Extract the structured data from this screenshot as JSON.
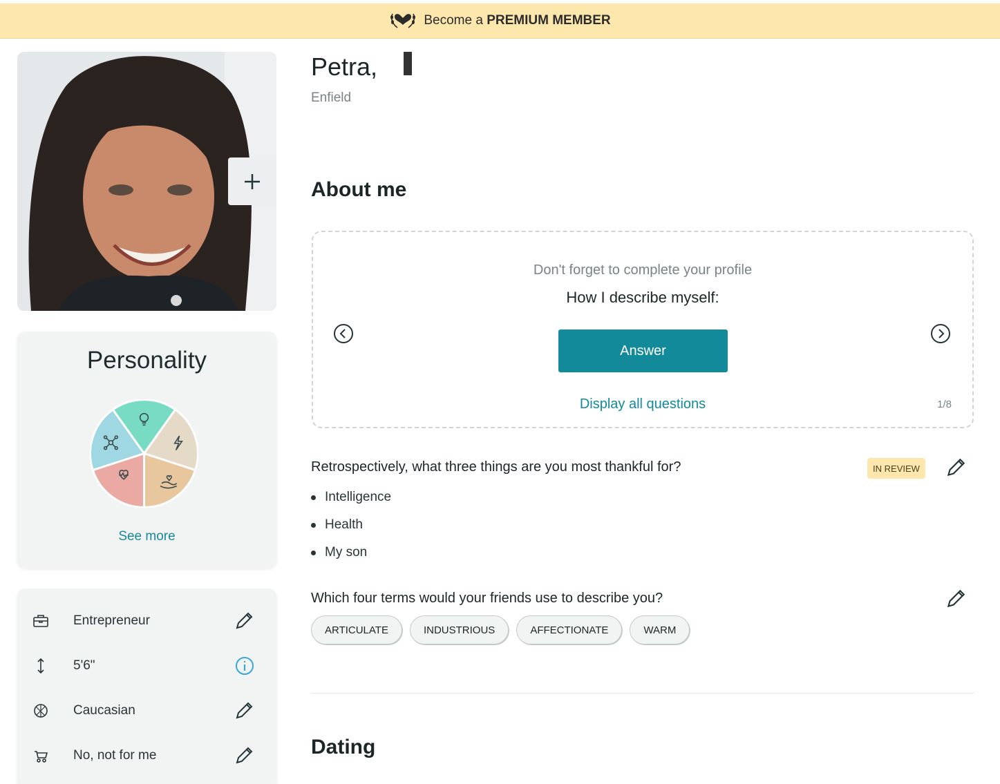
{
  "banner": {
    "prefix": "Become a",
    "highlight": "PREMIUM MEMBER"
  },
  "profile": {
    "name": "Petra,",
    "city": "Enfield"
  },
  "personality": {
    "title": "Personality",
    "see_more": "See more"
  },
  "details": [
    {
      "icon": "briefcase-icon",
      "label": "Entrepreneur",
      "action": "edit"
    },
    {
      "icon": "height-icon",
      "label": "5'6\"",
      "action": "info"
    },
    {
      "icon": "globe-icon",
      "label": "Caucasian",
      "action": "edit"
    },
    {
      "icon": "stroller-icon",
      "label": "No, not for me",
      "action": "edit"
    }
  ],
  "about": {
    "title": "About me",
    "prompt": {
      "hint": "Don't forget to complete your profile",
      "question": "How I describe myself:",
      "answer_button": "Answer",
      "display_all": "Display all questions",
      "pager": "1/8"
    },
    "q1": {
      "text": "Retrospectively, what three things are you most thankful for?",
      "badge": "IN REVIEW",
      "answers": [
        "Intelligence",
        "Health",
        "My son"
      ]
    },
    "q2": {
      "text": "Which four terms would your friends use to describe you?",
      "tags": [
        "ARTICULATE",
        "INDUSTRIOUS",
        "AFFECTIONATE",
        "WARM"
      ]
    }
  },
  "dating": {
    "title": "Dating"
  },
  "colors": {
    "accent": "#138a9a",
    "banner": "#fde7ad",
    "card": "#f2f3f3"
  }
}
